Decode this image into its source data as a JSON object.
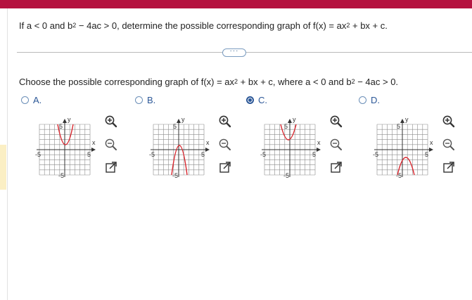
{
  "question": {
    "part1": "If a < 0 and b",
    "sup1": "2",
    "part2": " − 4ac > 0, determine the possible corresponding graph of f(x) = ax",
    "sup2": "2",
    "part3": " + bx + c."
  },
  "more_button": "···",
  "prompt": {
    "part1": "Choose the possible corresponding graph of f(x) = ax",
    "sup1": "2",
    "part2": " + bx + c, where a < 0 and b",
    "sup2": "2",
    "part3": " − 4ac > 0."
  },
  "graph_labels": {
    "x": "x",
    "y": "y",
    "pos5": "5",
    "neg5": "-5"
  },
  "options": [
    {
      "label": "A.",
      "selected": false
    },
    {
      "label": "B.",
      "selected": false
    },
    {
      "label": "C.",
      "selected": true
    },
    {
      "label": "D.",
      "selected": false
    }
  ],
  "icons": [
    "zoom-in-icon",
    "zoom-out-icon",
    "open-external-icon"
  ],
  "colors": {
    "brand": "#b5123f",
    "accent": "#2b5797",
    "curve": "#d9262e",
    "grid": "#8c8c8c"
  }
}
